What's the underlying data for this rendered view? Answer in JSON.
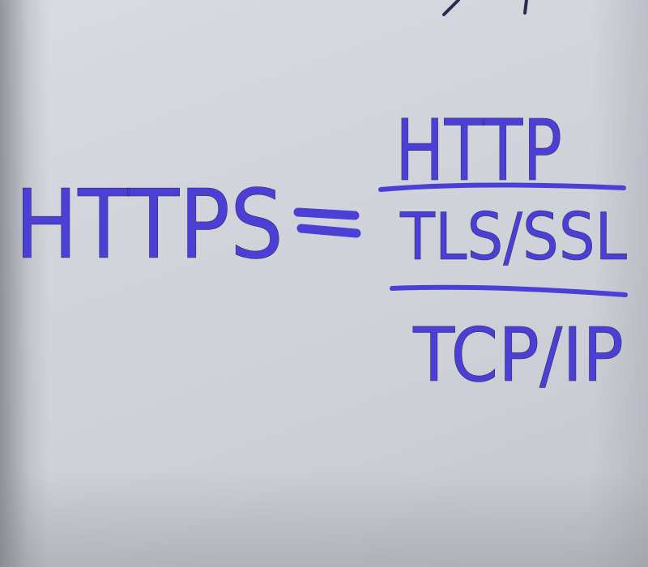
{
  "photo": {
    "subject": "handwritten whiteboard note",
    "ink_color": "#4b3fd6",
    "paper_color": "#d4d6de"
  },
  "equation": {
    "lhs": "HTTPS",
    "equals": "=",
    "layers": [
      "HTTP",
      "TLS/SSL",
      "TCP/IP"
    ]
  }
}
